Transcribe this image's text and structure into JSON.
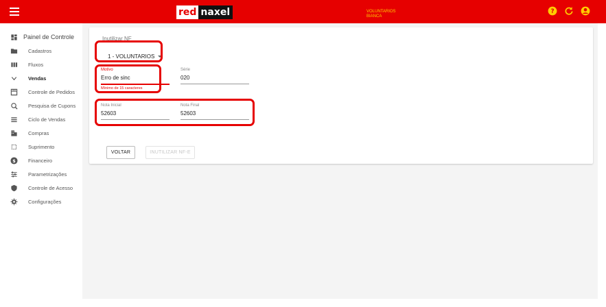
{
  "header": {
    "logo_red": "red",
    "logo_black": "naxel",
    "org_line1": "VOLUNTARIOS",
    "org_line2": "BIANCA",
    "icons": [
      "help-icon",
      "refresh-icon",
      "account-icon"
    ],
    "colors": {
      "bar": "#e60000",
      "icons": "#ffcc00"
    }
  },
  "sidebar": {
    "main": "Painel de Controle",
    "items": [
      {
        "label": "Cadastros",
        "icon": "folder-icon"
      },
      {
        "label": "Fluxos",
        "icon": "columns-icon"
      },
      {
        "label": "Vendas",
        "icon": "chevron-down-icon"
      },
      {
        "label": "Controle de Pedidos",
        "icon": "pedidos-icon"
      },
      {
        "label": "Pesquisa de Cupons",
        "icon": "search-refresh-icon"
      },
      {
        "label": "Ciclo de Vendas",
        "icon": "list-icon"
      },
      {
        "label": "Compras",
        "icon": "building-icon"
      },
      {
        "label": "Suprimento",
        "icon": "crop-icon"
      },
      {
        "label": "Financeiro",
        "icon": "dollar-icon"
      },
      {
        "label": "Parametrizações",
        "icon": "sliders-icon"
      },
      {
        "label": "Controle de Acesso",
        "icon": "shield-icon"
      },
      {
        "label": "Configurações",
        "icon": "gear-icon"
      }
    ]
  },
  "form": {
    "title": "Inutilizar NF",
    "select_value": "1 - VOLUNTARIOS",
    "motivo": {
      "label": "Motivo",
      "value": "Erro de sinc",
      "error": "Mínimo de 15 caracteres"
    },
    "serie": {
      "label": "Série",
      "value": "020"
    },
    "nota_inicial": {
      "label": "Nota Inicial",
      "value": "52603"
    },
    "nota_final": {
      "label": "Nota Final",
      "value": "52603"
    },
    "btn_voltar": "VOLTAR",
    "btn_inutilizar": "INUTILIZAR NF-E"
  }
}
